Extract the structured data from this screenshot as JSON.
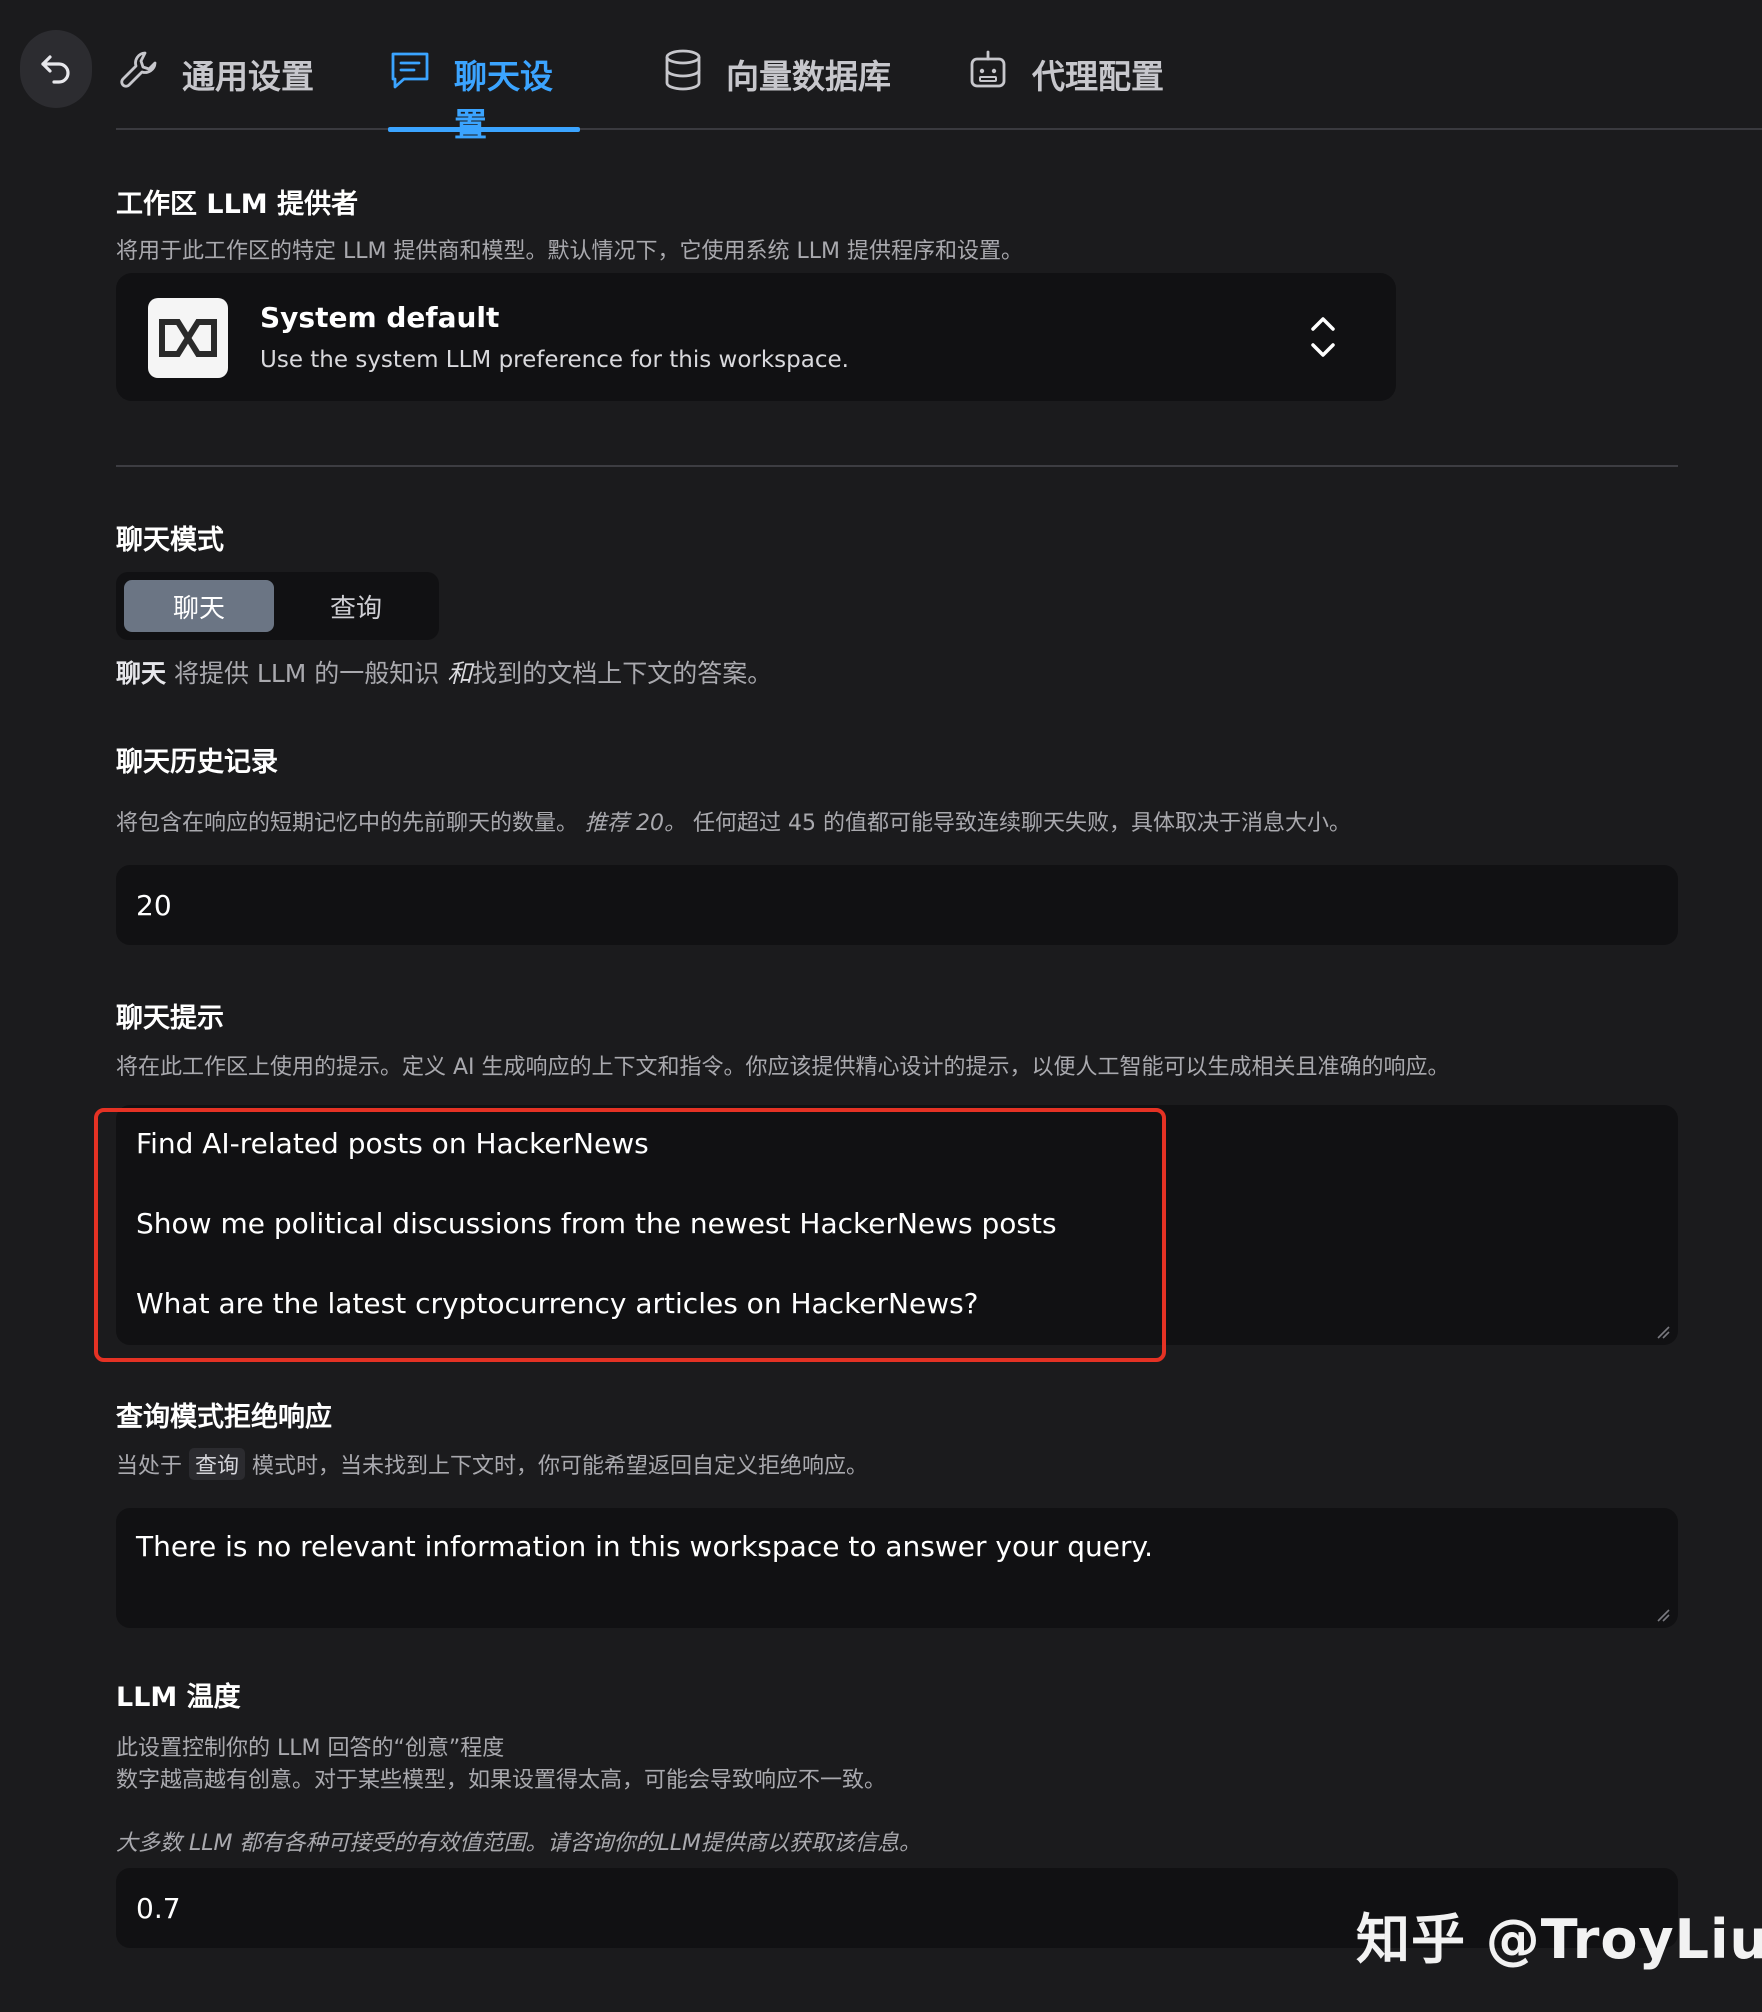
{
  "tabs": [
    {
      "label": "通用设置",
      "icon": "wrench-icon"
    },
    {
      "label": "聊天设置",
      "icon": "chat-icon"
    },
    {
      "label": "向量数据库",
      "icon": "database-icon"
    },
    {
      "label": "代理配置",
      "icon": "robot-icon"
    }
  ],
  "active_tab": "聊天设置",
  "provider": {
    "title": "工作区 LLM 提供者",
    "description": "将用于此工作区的特定 LLM 提供商和模型。默认情况下，它使用系统 LLM 提供程序和设置。",
    "selected_name": "System default",
    "selected_description": "Use the system LLM preference for this workspace."
  },
  "chat_mode": {
    "title": "聊天模式",
    "options": [
      "聊天",
      "查询"
    ],
    "selected": "聊天",
    "desc_bold": "聊天",
    "desc_part1": " 将提供 LLM 的一般知识 ",
    "desc_italic": "和",
    "desc_part2": "找到的文档上下文的答案。"
  },
  "history": {
    "title": "聊天历史记录",
    "desc_part1": "将包含在响应的短期记忆中的先前聊天的数量。",
    "desc_italic": "推荐 20。",
    "desc_part2": "任何超过 45 的值都可能导致连续聊天失败，具体取决于消息大小。",
    "value": "20"
  },
  "prompt": {
    "title": "聊天提示",
    "description": "将在此工作区上使用的提示。定义 AI 生成响应的上下文和指令。你应该提供精心设计的提示，以便人工智能可以生成相关且准确的响应。",
    "lines": [
      "Find AI-related posts on HackerNews",
      "Show me political discussions from the newest HackerNews posts",
      "What are the latest cryptocurrency articles on HackerNews?"
    ]
  },
  "refusal": {
    "title": "查询模式拒绝响应",
    "desc_part1": "当处于 ",
    "desc_chip": "查询",
    "desc_part2": " 模式时，当未找到上下文时，你可能希望返回自定义拒绝响应。",
    "value": "There is no relevant information in this workspace to answer your query."
  },
  "temperature": {
    "title": "LLM 温度",
    "desc_line1": "此设置控制你的 LLM 回答的“创意”程度",
    "desc_line2": "数字越高越有创意。对于某些模型，如果设置得太高，可能会导致响应不一致。",
    "desc_note": "大多数 LLM 都有各种可接受的有效值范围。请咨询你的LLM提供商以获取该信息。",
    "value": "0.7"
  },
  "watermark": "知乎 @TroyLiu",
  "colors": {
    "accent": "#3ba4ff",
    "background": "#1b1b1d",
    "field": "#111113",
    "highlight": "#e53224"
  }
}
